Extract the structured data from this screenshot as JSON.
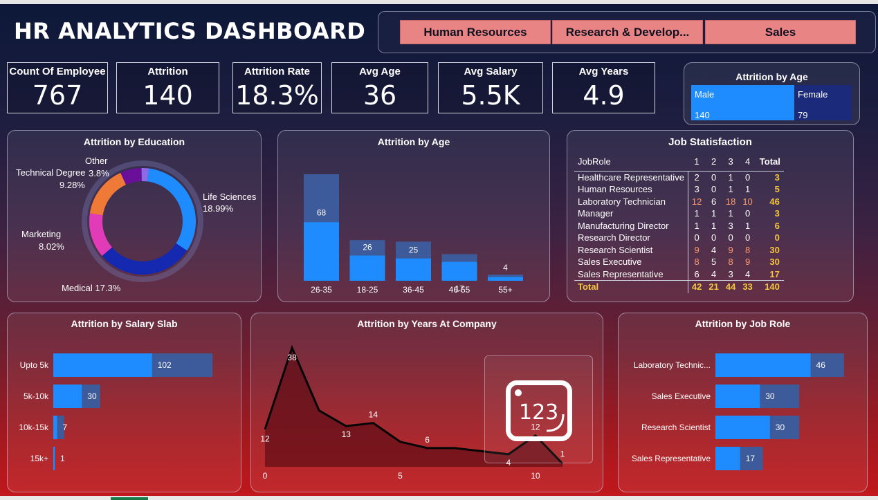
{
  "title": "HR ANALYTICS DASHBOARD",
  "slicer": [
    "Human Resources",
    "Research & Develop...",
    "Sales"
  ],
  "kpis": [
    {
      "label": "Count Of Employee",
      "value": "767"
    },
    {
      "label": "Attrition",
      "value": "140"
    },
    {
      "label": "Attrition Rate",
      "value": "18.3%"
    },
    {
      "label": "Avg Age",
      "value": "36"
    },
    {
      "label": "Avg Salary",
      "value": "5.5K"
    },
    {
      "label": "Avg Years",
      "value": "4.9"
    }
  ],
  "gender": {
    "title": "Attrition by Age",
    "male_label": "Male",
    "male_value": "140",
    "female_label": "Female",
    "female_value": "79"
  },
  "education": {
    "title": "Attrition by Education",
    "labels": {
      "other": "Other",
      "other_pct": "3.8%",
      "tech": "Technical Degree",
      "tech_pct": "9.28%",
      "life": "Life Sciences",
      "life_pct": "18.99%",
      "marketing": "Marketing",
      "marketing_pct": "8.02%",
      "medical": "Medical 17.3%"
    }
  },
  "age_chart": {
    "title": "Attrition by Age",
    "max": 68,
    "bars": [
      {
        "cat": "26-35",
        "label": "68",
        "value": 68,
        "fill": 0.55
      },
      {
        "cat": "18-25",
        "label": "26",
        "value": 26,
        "fill": 0.62
      },
      {
        "cat": "36-45",
        "label": "25",
        "value": 25,
        "fill": 0.57
      },
      {
        "cat": "46-55",
        "label": "17",
        "value": 17,
        "fill": 0.71
      },
      {
        "cat": "55+",
        "label": "4",
        "value": 4,
        "fill": 0.6
      }
    ]
  },
  "job_sat": {
    "title": "Job Statisfaction",
    "headers": [
      "JobRole",
      "1",
      "2",
      "3",
      "4",
      "Total"
    ],
    "rows": [
      [
        "Healthcare Representative",
        "2",
        "0",
        "1",
        "0",
        "3"
      ],
      [
        "Human Resources",
        "3",
        "0",
        "1",
        "1",
        "5"
      ],
      [
        "Laboratory Technician",
        "12",
        "6",
        "18",
        "10",
        "46"
      ],
      [
        "Manager",
        "1",
        "1",
        "1",
        "0",
        "3"
      ],
      [
        "Manufacturing Director",
        "1",
        "1",
        "3",
        "1",
        "6"
      ],
      [
        "Research Director",
        "0",
        "0",
        "0",
        "0",
        "0"
      ],
      [
        "Research Scientist",
        "9",
        "4",
        "9",
        "8",
        "30"
      ],
      [
        "Sales Executive",
        "8",
        "5",
        "8",
        "9",
        "30"
      ],
      [
        "Sales Representative",
        "6",
        "4",
        "3",
        "4",
        "17"
      ]
    ],
    "total": [
      "Total",
      "42",
      "21",
      "44",
      "33",
      "140"
    ]
  },
  "salary": {
    "title": "Attrition by Salary Slab",
    "bars": [
      {
        "cat": "Upto 5k",
        "label": "102",
        "value": 102,
        "fill": 0.62
      },
      {
        "cat": "5k-10k",
        "label": "30",
        "value": 30,
        "fill": 0.61
      },
      {
        "cat": "10k-15k",
        "label": "7",
        "value": 7,
        "fill": 0.35
      },
      {
        "cat": "15k+",
        "label": "1",
        "value": 1,
        "fill": 0.6
      }
    ],
    "max": 113
  },
  "years": {
    "title": "Attrition by Years At Company",
    "points": [
      12,
      38,
      18,
      13,
      14,
      8,
      6,
      6,
      5,
      4,
      10,
      1
    ],
    "labels": [
      {
        "i": 0,
        "text": "12"
      },
      {
        "i": 1,
        "text": "38"
      },
      {
        "i": 3,
        "text": "13"
      },
      {
        "i": 4,
        "text": "14"
      },
      {
        "i": 6,
        "text": "6"
      },
      {
        "i": 9,
        "text": "4"
      },
      {
        "i": 10,
        "text": "12"
      },
      {
        "i": 11,
        "text": "1"
      }
    ],
    "ticks": [
      "0",
      "5",
      "10"
    ],
    "overlay": "123"
  },
  "jobrole": {
    "title": "Attrition by Job Role",
    "bars": [
      {
        "cat": "Laboratory Technic...",
        "label": "46",
        "value": 46,
        "fill": 0.74
      },
      {
        "cat": "Sales Executive",
        "label": "30",
        "value": 30,
        "fill": 0.53
      },
      {
        "cat": "Research Scientist",
        "label": "30",
        "value": 30,
        "fill": 0.65
      },
      {
        "cat": "Sales Representative",
        "label": "17",
        "value": 17,
        "fill": 0.52
      }
    ],
    "max": 50
  },
  "chart_data": [
    {
      "type": "bar",
      "title": "Attrition by Age",
      "categories": [
        "26-35",
        "18-25",
        "36-45",
        "46-55",
        "55+"
      ],
      "values": [
        68,
        26,
        25,
        17,
        4
      ]
    },
    {
      "type": "bar",
      "title": "Attrition by Salary Slab",
      "categories": [
        "Upto 5k",
        "5k-10k",
        "10k-15k",
        "15k+"
      ],
      "values": [
        102,
        30,
        7,
        1
      ]
    },
    {
      "type": "bar",
      "title": "Attrition by Job Role",
      "categories": [
        "Laboratory Technic...",
        "Sales Executive",
        "Research Scientist",
        "Sales Representative"
      ],
      "values": [
        46,
        30,
        30,
        17
      ]
    },
    {
      "type": "area",
      "title": "Attrition by Years At Company",
      "x": [
        0,
        1,
        2,
        3,
        4,
        5,
        6,
        7,
        8,
        9,
        10,
        11
      ],
      "values": [
        12,
        38,
        18,
        13,
        14,
        8,
        6,
        6,
        5,
        4,
        10,
        1
      ]
    },
    {
      "type": "pie",
      "title": "Attrition by Education",
      "categories": [
        "Life Sciences",
        "Medical",
        "Marketing",
        "Technical Degree",
        "Other"
      ],
      "values": [
        18.99,
        17.3,
        8.02,
        9.28,
        3.8
      ]
    }
  ],
  "colors": {
    "bar": "#1e8cff",
    "bar_bg": "#3d5a9a",
    "accent": "#e88484",
    "total": "#f5c542"
  }
}
